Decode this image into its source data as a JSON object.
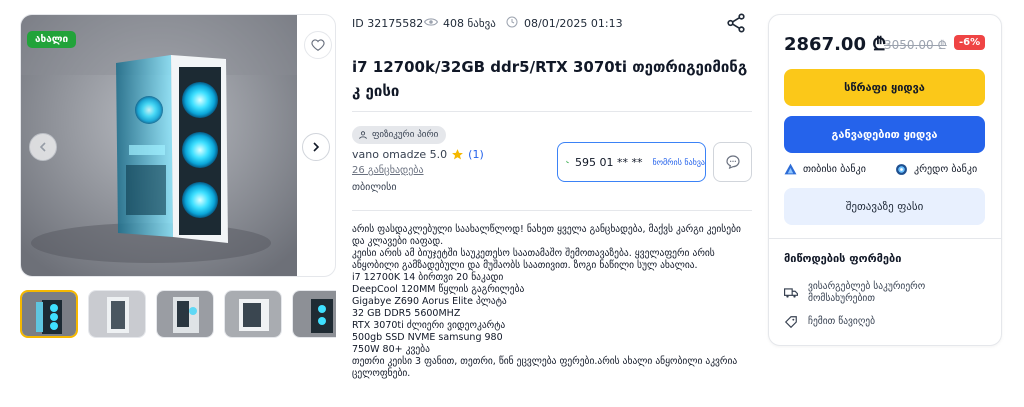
{
  "gallery": {
    "badge": "ახალი",
    "thumb_count": 5
  },
  "meta": {
    "id": "ID 32175582",
    "views": "408 ნახვა",
    "date": "08/01/2025 01:13"
  },
  "title": "i7 12700k/32GB ddr5/RTX 3070ti თეთრიგეიმინგ კ ეისი",
  "seller": {
    "type": "ფიზიკური პირი",
    "name": "vano omadze 5.0",
    "reviews": "(1)",
    "listings": "26 განცხადება",
    "city": "თბილისი"
  },
  "phone": {
    "number": "595 01 ** **",
    "show_label": "ნომრის ნახვა"
  },
  "description": "არის ფასდაკლებული საახალწლოდ! ნახეთ ყველა განცხადება, მაქვს კარგი კეისები და კლავები იაფად.\nკეისი არის ამ ბიუჯეტში საუკეთესო საათამაშო შემოთავაზება. ყველაფერი არის ანყობილი გამზადებული და მუშაობს საათივით. ზოგი ნაწილი სულ ახალია.\ni7 12700K 14 ბირთვი 20 ნაკადი\nDeepCool 120MM წყლის გაგრილება\nGigabye Z690 Aorus Elite პლატა\n32 GB DDR5 5600MHZ\nRTX 3070ti ძლიერი ვიდეოკარტა\n500gb SSD NVME samsung 980\n750W 80+ კვება\nთეთრი კეისი 3 ფანით, თეთრი, წინ ეცვლება ფერები.არის ახალი ანყობილი აკვრია ცელოფნები.",
  "purchase": {
    "price": "2867.00 ₾",
    "old_price": "3050.00 ₾",
    "discount": "-6%",
    "buy_label": "სწრაფი ყიდვა",
    "installment_label": "განვადებით ყიდვა",
    "bank1": "თიბისი ბანკი",
    "bank2": "კრედო ბანკი",
    "offer_label": "შეთავაზე ფასი",
    "delivery_title": "მიწოდების ფორმები",
    "delivery1": "ვისარგებლებ საკურიერო\nმომსახურებით",
    "delivery2": "ჩემით წავიღებ"
  },
  "colors": {
    "accent_yellow": "#fbc819",
    "accent_blue": "#2563eb",
    "new_badge": "#22a33a",
    "discount": "#ef4444"
  }
}
